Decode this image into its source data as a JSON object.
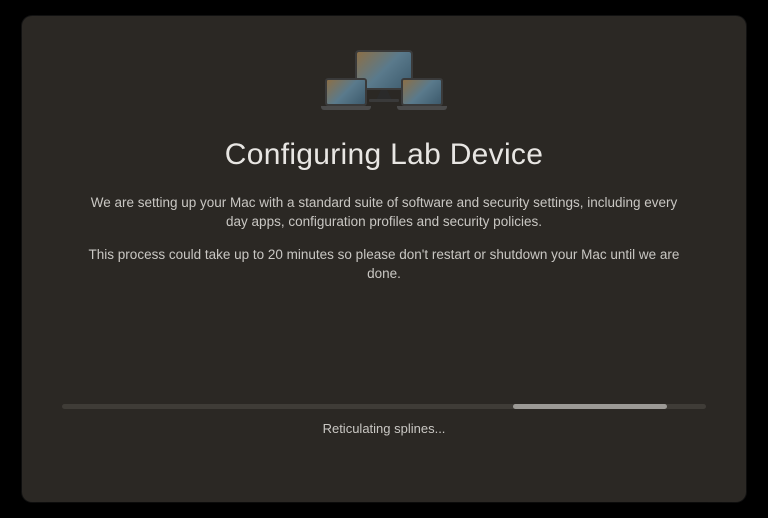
{
  "title": "Configuring Lab Device",
  "description_line1": "We are setting up your Mac with a standard suite of software and security settings, including every day apps, configuration profiles and security policies.",
  "description_line2": "This process could take up to 20 minutes so please don't restart or shutdown your Mac until we are done.",
  "status_text": "Reticulating splines...",
  "progress": {
    "indeterminate": true,
    "segment_left_percent": 70,
    "segment_width_percent": 24
  },
  "colors": {
    "window_bg": "#2b2824",
    "text_primary": "#e8e6e3",
    "text_secondary": "#c9c7c3",
    "progress_track": "#3f3c37",
    "progress_fill": "#9c9a96"
  }
}
